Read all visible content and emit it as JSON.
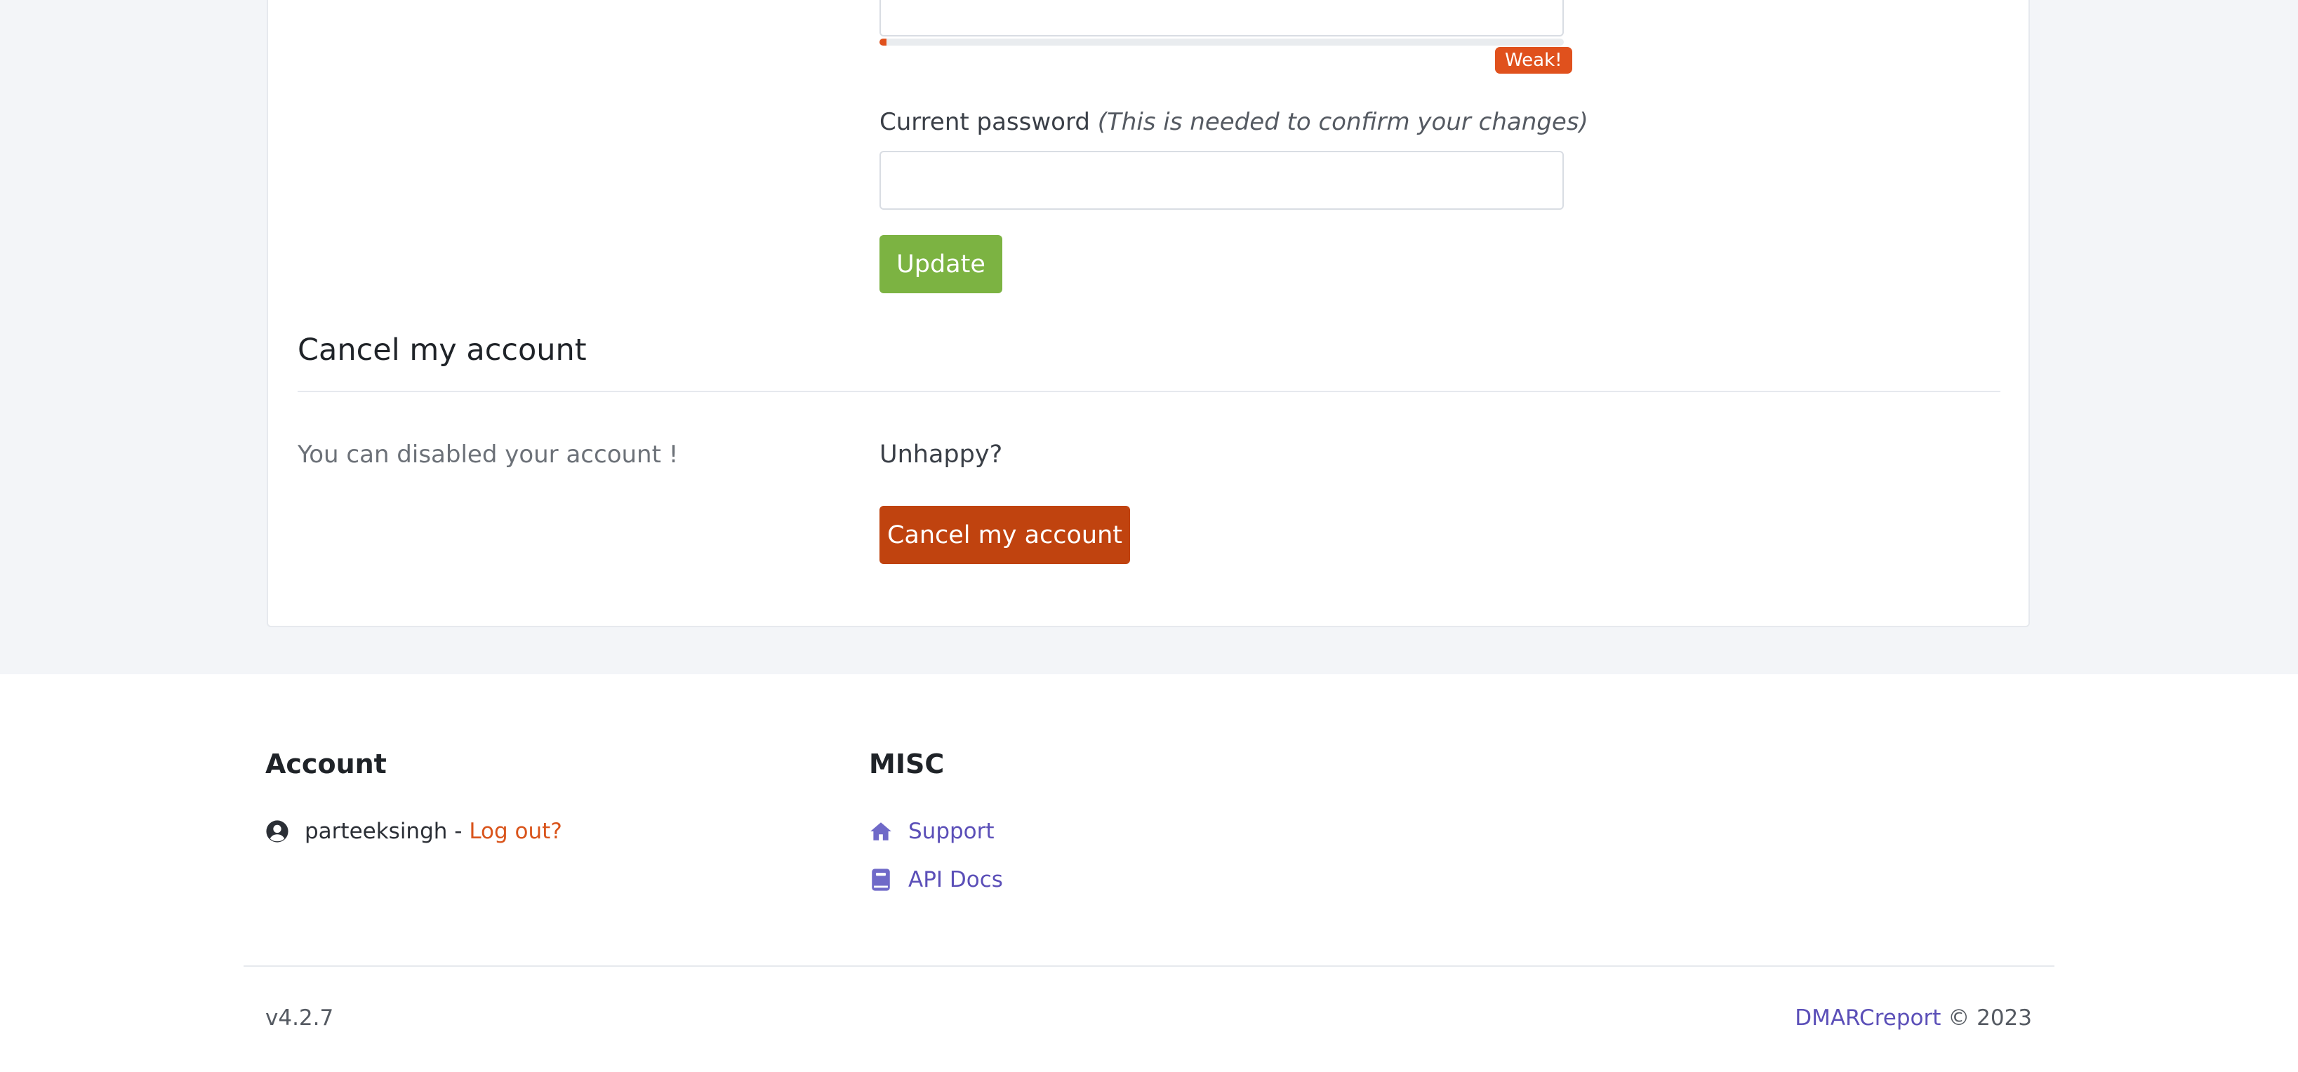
{
  "password_strength": {
    "label": "Weak!",
    "level": 0.01,
    "color": "#e0511d"
  },
  "current_password": {
    "label": "Current password",
    "hint": "(This is needed to confirm your changes)",
    "value": ""
  },
  "update_button": {
    "label": "Update",
    "color": "#7cb342"
  },
  "cancel_section": {
    "title": "Cancel my account",
    "description": "You can disabled your account !",
    "prompt": "Unhappy?",
    "button_label": "Cancel my account",
    "button_color": "#c0430f"
  },
  "footer": {
    "account": {
      "heading": "Account",
      "username": "parteeksingh",
      "separator": " - ",
      "logout_label": "Log out?",
      "icon": "user-circle-icon"
    },
    "misc": {
      "heading": "MISC",
      "links": [
        {
          "label": "Support",
          "icon": "home-icon"
        },
        {
          "label": "API Docs",
          "icon": "book-icon"
        }
      ]
    },
    "version": "v4.2.7",
    "brand": "DMARCreport",
    "copyright": "© 2023"
  }
}
